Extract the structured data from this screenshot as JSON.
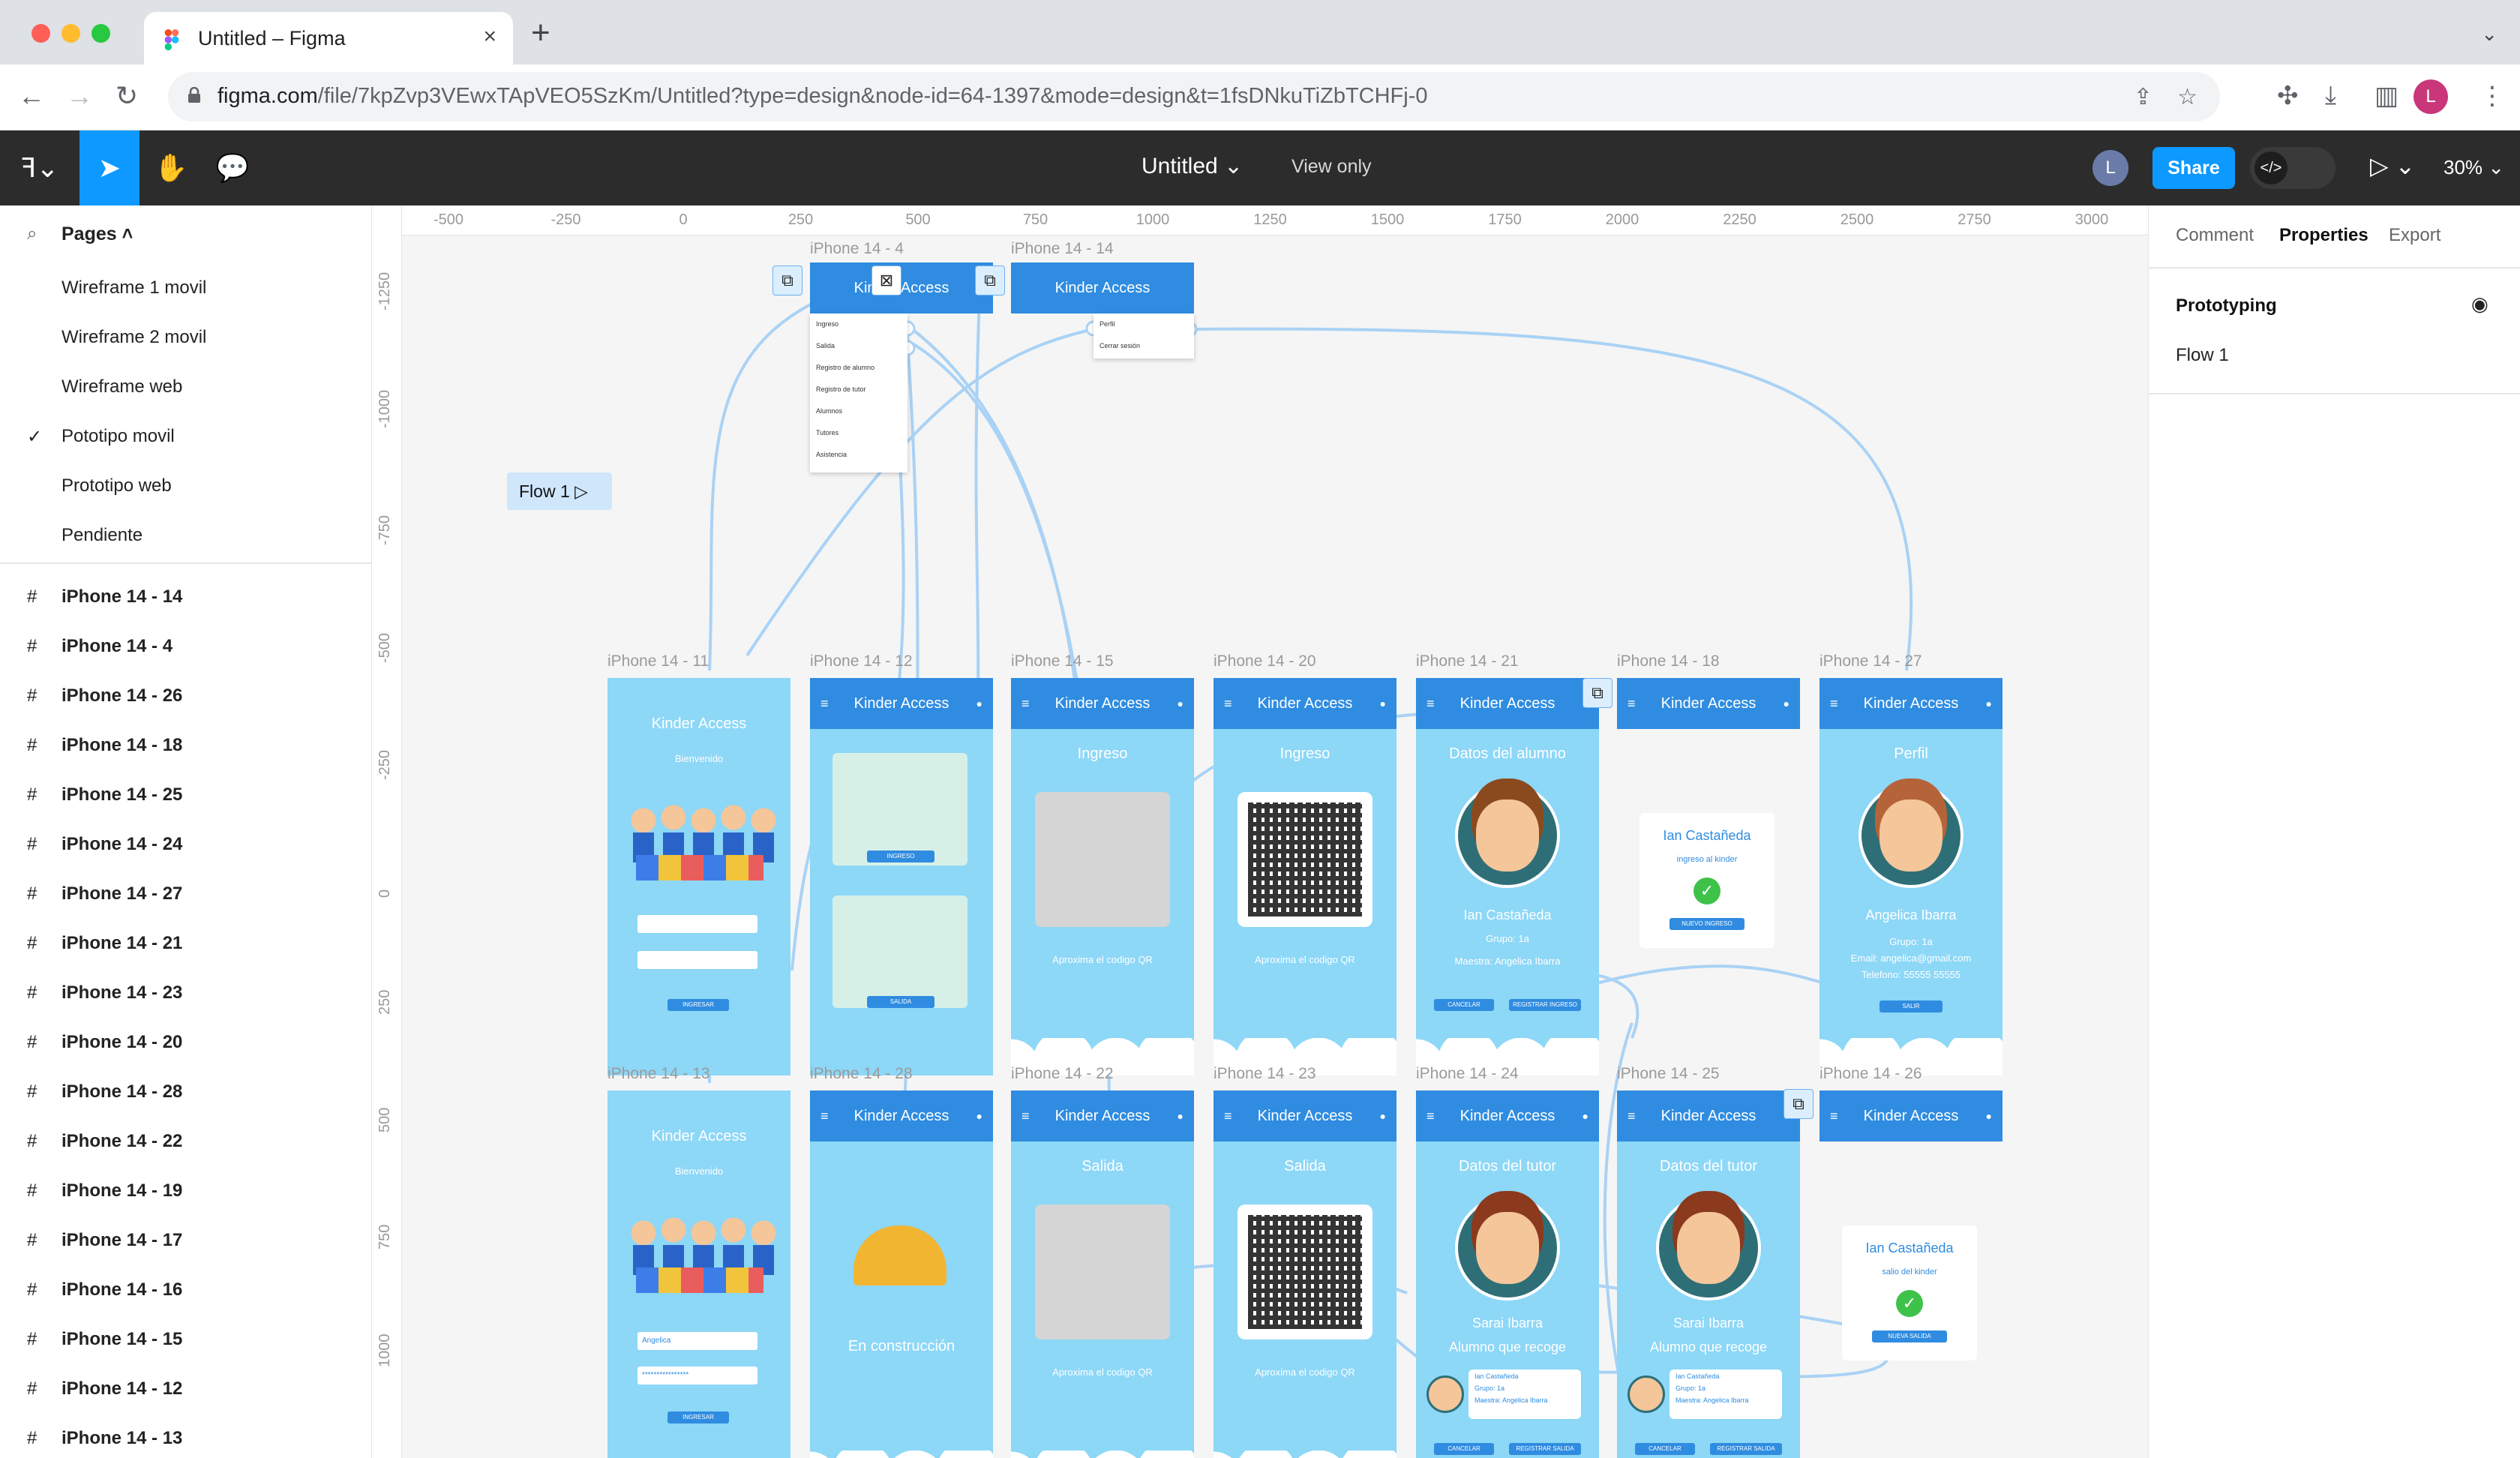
{
  "browser": {
    "tab_title": "Untitled – Figma",
    "url_host": "figma.com",
    "url_path": "/file/7kpZvp3VEwxTApVEO5SzKm/Untitled?type=design&node-id=64-1397&mode=design&t=1fsDNkuTiZbTCHFj-0",
    "profile_initial": "L"
  },
  "toolbar": {
    "doc_title": "Untitled",
    "view_only": "View only",
    "user_initial": "L",
    "share_label": "Share",
    "zoom": "30%"
  },
  "pages": {
    "header": "Pages",
    "items": [
      "Wireframe 1 movil",
      "Wireframe 2 movil",
      "Wireframe web",
      "Pototipo movil",
      "Prototipo web",
      "Pendiente"
    ],
    "selected_index": 3
  },
  "layers": [
    "iPhone 14 - 14",
    "iPhone 14 - 4",
    "iPhone 14 - 26",
    "iPhone 14 - 18",
    "iPhone 14 - 25",
    "iPhone 14 - 24",
    "iPhone 14 - 27",
    "iPhone 14 - 21",
    "iPhone 14 - 23",
    "iPhone 14 - 20",
    "iPhone 14 - 28",
    "iPhone 14 - 22",
    "iPhone 14 - 19",
    "iPhone 14 - 17",
    "iPhone 14 - 16",
    "iPhone 14 - 15",
    "iPhone 14 - 12",
    "iPhone 14 - 13"
  ],
  "ruler_x": [
    "-500",
    "-250",
    "0",
    "250",
    "500",
    "750",
    "1000",
    "1250",
    "1500",
    "1750",
    "2000",
    "2250",
    "2500",
    "2750",
    "3000"
  ],
  "ruler_y": [
    "-1250",
    "-1000",
    "-750",
    "-500",
    "-250",
    "0",
    "250",
    "500",
    "750",
    "1000"
  ],
  "canvas": {
    "flow_badge": "Flow 1",
    "top_frames": [
      {
        "label": "iPhone 14 - 4",
        "header": "Kinder Access",
        "menu": [
          "Ingreso",
          "Salida",
          "Registro de alumno",
          "Registro de tutor",
          "Alumnos",
          "Tutores",
          "Asistencia"
        ]
      },
      {
        "label": "iPhone 14 - 14",
        "header": "Kinder Access",
        "menu": [
          "Perfil",
          "Cerrar sesión"
        ]
      }
    ],
    "row1": [
      {
        "label": "iPhone 14 - 11",
        "title": "Kinder Access",
        "sub": "Bienvenido",
        "button": "INGRESAR"
      },
      {
        "label": "iPhone 14 - 12",
        "header": "Kinder Access",
        "btn1": "INGRESO",
        "btn2": "SALIDA"
      },
      {
        "label": "iPhone 14 - 15",
        "header": "Kinder Access",
        "title": "Ingreso",
        "hint": "Aproxima el codigo QR"
      },
      {
        "label": "iPhone 14 - 20",
        "header": "Kinder Access",
        "title": "Ingreso",
        "hint": "Aproxima el codigo QR"
      },
      {
        "label": "iPhone 14 - 21",
        "header": "Kinder Access",
        "title": "Datos del alumno",
        "name": "Ian Castañeda",
        "group": "Grupo: 1a",
        "teacher": "Maestra: Angelica Ibarra",
        "btn1": "CANCELAR",
        "btn2": "REGISTRAR INGRESO"
      },
      {
        "label": "iPhone 14 - 18",
        "header": "Kinder Access",
        "name": "Ian Castañeda",
        "msg": "ingreso al kinder",
        "btn": "NUEVO INGRESO"
      },
      {
        "label": "iPhone 14 - 27",
        "header": "Kinder Access",
        "title": "Perfil",
        "name": "Angelica Ibarra",
        "group": "Grupo: 1a",
        "email": "Email: angelica@gmail.com",
        "phone": "Telefono: 55555 55555",
        "btn": "SALIR"
      }
    ],
    "row2": [
      {
        "label": "iPhone 14 - 13",
        "title": "Kinder Access",
        "sub": "Bienvenido",
        "user": "Angelica",
        "pass": "****************",
        "button": "INGRESAR"
      },
      {
        "label": "iPhone 14 - 28",
        "header": "Kinder Access",
        "title": "En construcción"
      },
      {
        "label": "iPhone 14 - 22",
        "header": "Kinder Access",
        "title": "Salida",
        "hint": "Aproxima el codigo QR"
      },
      {
        "label": "iPhone 14 - 23",
        "header": "Kinder Access",
        "title": "Salida",
        "hint": "Aproxima el codigo QR"
      },
      {
        "label": "iPhone 14 - 24",
        "header": "Kinder Access",
        "title": "Datos del tutor",
        "name": "Sarai Ibarra",
        "sub": "Alumno que recoge",
        "kid": "Ian Castañeda",
        "group": "Grupo: 1a",
        "teacher": "Maestra: Angelica Ibarra",
        "btn1": "CANCELAR",
        "btn2": "REGISTRAR SALIDA"
      },
      {
        "label": "iPhone 14 - 25",
        "header": "Kinder Access",
        "title": "Datos del tutor",
        "name": "Sarai Ibarra",
        "sub": "Alumno que recoge",
        "kid": "Ian Castañeda",
        "group": "Grupo: 1a",
        "teacher": "Maestra: Angelica Ibarra",
        "btn1": "CANCELAR",
        "btn2": "REGISTRAR SALIDA"
      },
      {
        "label": "iPhone 14 - 26",
        "header": "Kinder Access",
        "name": "Ian Castañeda",
        "msg": "salio del kinder",
        "btn": "NUEVA SALIDA"
      }
    ]
  },
  "rightpanel": {
    "tabs": [
      "Comment",
      "Properties",
      "Export"
    ],
    "active_tab": 1,
    "section": "Prototyping",
    "flow": "Flow 1"
  },
  "colors": {
    "accent": "#0d99ff",
    "frame_bg": "#8dd7f7",
    "frame_header": "#2f8ce0",
    "wire": "#a9d2f5"
  }
}
